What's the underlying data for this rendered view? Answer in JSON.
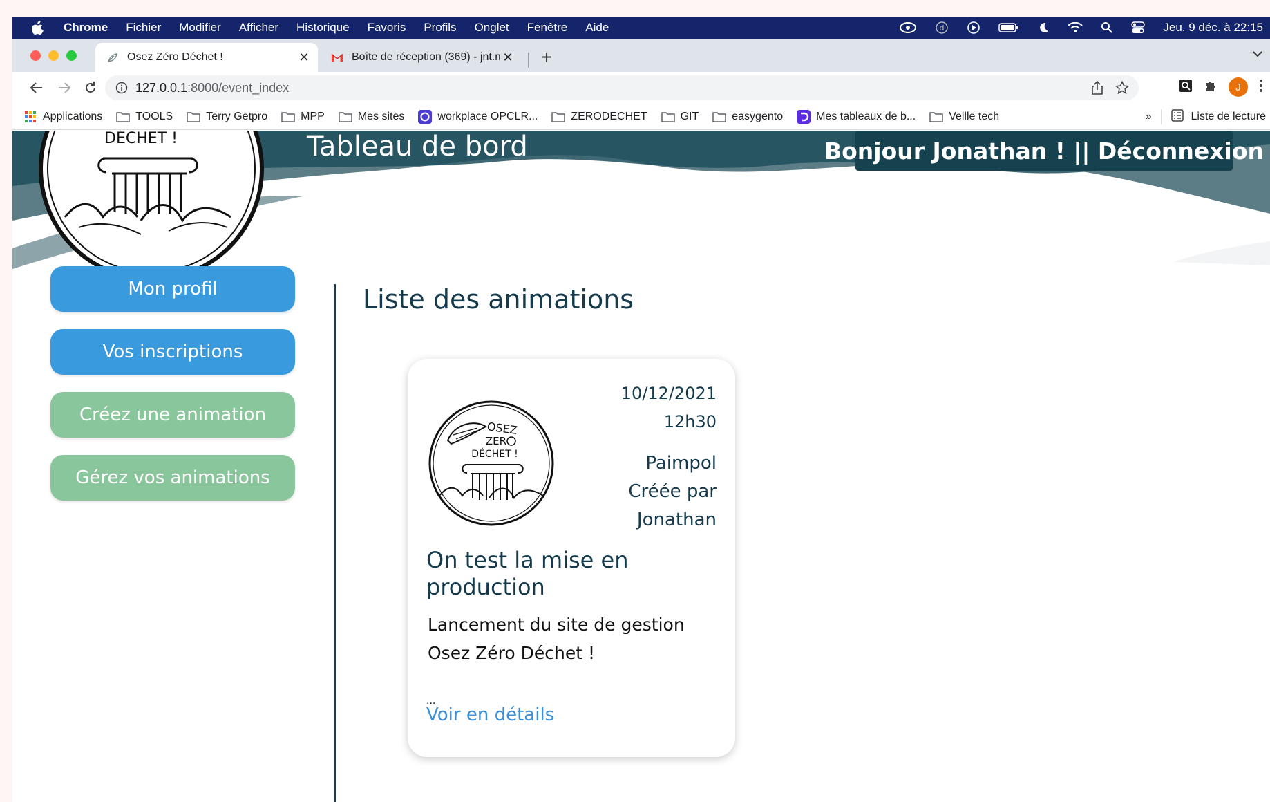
{
  "menubar": {
    "app": "Chrome",
    "items": [
      "Fichier",
      "Modifier",
      "Afficher",
      "Historique",
      "Favoris",
      "Profils",
      "Onglet",
      "Fenêtre",
      "Aide"
    ],
    "clock": "Jeu. 9 déc. à  22:15"
  },
  "tabs": [
    {
      "title": "Osez Zéro Déchet !",
      "icon": "leaf-favicon-icon",
      "close": "✕"
    },
    {
      "title": "Boîte de réception (369) - jnt.m",
      "icon": "gmail-icon",
      "close": "✕"
    }
  ],
  "newtab": "+",
  "toolbar": {
    "url_host": "127.0.0.1",
    "url_rest": ":8000/event_index"
  },
  "bookmarks": {
    "items": [
      {
        "label": "Applications",
        "icon": "apps-grid-icon"
      },
      {
        "label": "TOOLS",
        "icon": "folder-icon"
      },
      {
        "label": "Terry Getpro",
        "icon": "folder-icon"
      },
      {
        "label": "MPP",
        "icon": "folder-icon"
      },
      {
        "label": "Mes sites",
        "icon": "folder-icon"
      },
      {
        "label": "workplace OPCLR...",
        "icon": "workplace-icon"
      },
      {
        "label": "ZERODECHET",
        "icon": "folder-icon"
      },
      {
        "label": "GIT",
        "icon": "folder-icon"
      },
      {
        "label": "easygento",
        "icon": "folder-icon"
      },
      {
        "label": "Mes tableaux de b...",
        "icon": "dashboard-icon"
      },
      {
        "label": "Veille tech",
        "icon": "folder-icon"
      }
    ],
    "more": "»",
    "reading_list": "Liste de lecture"
  },
  "avatar_letter": "J",
  "header": {
    "title": "Tableau de bord",
    "greeting": "Bonjour Jonathan !  || Déconnexion",
    "logo_text": "DÉCHET !"
  },
  "sidebar": {
    "buttons": [
      {
        "label": "Mon profil",
        "color": "#3a9ade"
      },
      {
        "label": "Vos inscriptions",
        "color": "#3a9ade"
      },
      {
        "label": "Créez une animation",
        "color": "#8ac69c"
      },
      {
        "label": "Gérez vos animations",
        "color": "#8ac69c"
      }
    ]
  },
  "main": {
    "section_title": "Liste des animations",
    "card": {
      "date": "10/12/2021",
      "time": "12h30",
      "city": "Paimpol",
      "created_by_label": "Créée par",
      "creator": "Jonathan",
      "title": "On test la mise en production",
      "description": "Lancement du site de gestion Osez Zéro Déchet !",
      "ellipsis": "...",
      "link": "Voir en détails",
      "logo_lines": [
        "OSEZ",
        "ZER",
        "DÉCHET !"
      ]
    }
  },
  "colors": {
    "menubar": "#14256b",
    "wave_dark": "#1f4e5c",
    "wave_mid": "#5c7d86",
    "accent_blue": "#3a9ade",
    "accent_green": "#8ac69c",
    "title_text": "#143a4c",
    "link": "#3a8fd6"
  }
}
